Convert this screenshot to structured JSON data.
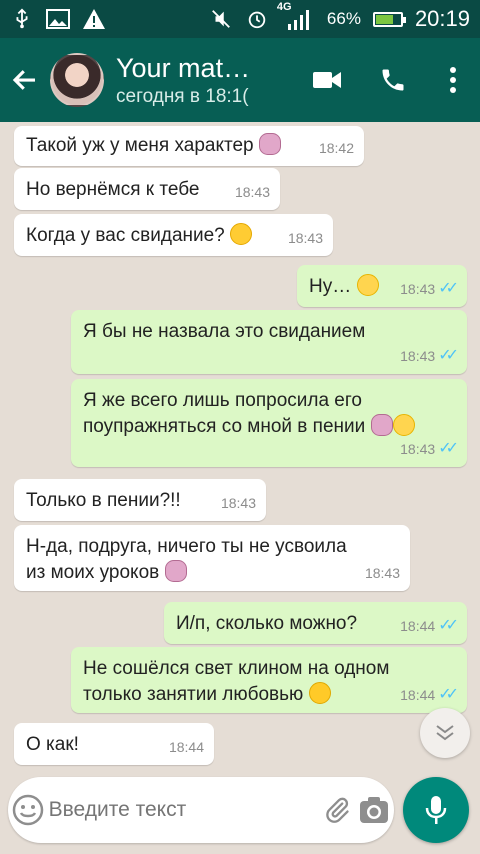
{
  "status_bar": {
    "network": "4G",
    "battery_percent": "66%",
    "battery_level": 0.66,
    "time": "20:19"
  },
  "header": {
    "title": "Your mat…🎸",
    "subtitle": "сегодня в 18:1("
  },
  "messages": [
    {
      "dir": "in",
      "text": "Такой уж у меня характер",
      "emoji": "person",
      "time": "18:42"
    },
    {
      "dir": "in",
      "text": "Но вернёмся к тебе",
      "time": "18:43"
    },
    {
      "dir": "in",
      "text": "Когда у вас свидание?",
      "emoji": "wink",
      "time": "18:43"
    },
    {
      "dir": "out",
      "text": "Ну…",
      "emoji": "smile",
      "time": "18:43"
    },
    {
      "dir": "out",
      "text": "Я бы не назвала это свиданием",
      "time": "18:43"
    },
    {
      "dir": "out",
      "text_line1": "Я же всего лишь попросила его",
      "text_line2": "поупражняться со мной в пении",
      "time": "18:43"
    },
    {
      "dir": "in",
      "text": "Только в пении?!!",
      "time": "18:43"
    },
    {
      "dir": "in",
      "text_line1": "Н-да, подруга, ничего ты не усвоила",
      "text_line2": "из моих уроков",
      "time": "18:43"
    },
    {
      "dir": "out",
      "text": "И/п, сколько можно?",
      "time": "18:44"
    },
    {
      "dir": "out",
      "text_line1": "Не сошёлся свет клином на одном",
      "text_line2": "только занятии любовью",
      "time": "18:44"
    },
    {
      "dir": "in",
      "text": "О как!",
      "time": "18:44"
    }
  ],
  "input": {
    "placeholder": "Введите текст"
  },
  "colors": {
    "header": "#075e54",
    "status_bar": "#0a4a44",
    "outgoing_bubble": "#dcf8c6",
    "incoming_bubble": "#ffffff",
    "read_ticks": "#4fc3f7",
    "mic_button": "#00897b"
  }
}
